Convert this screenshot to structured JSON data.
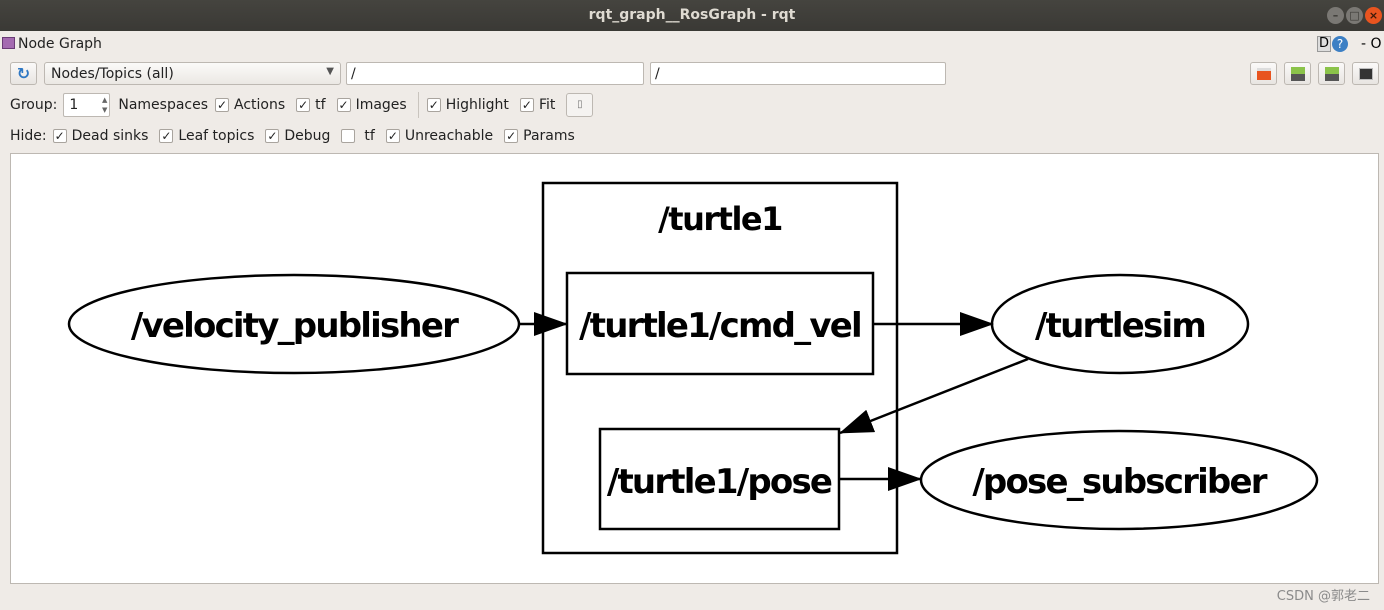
{
  "window": {
    "title": "rqt_graph__RosGraph - rqt"
  },
  "plugin": {
    "title": "Node Graph",
    "d_label": "D",
    "extra": "- O"
  },
  "toolbar": {
    "view_mode": "Nodes/Topics (all)",
    "node_filter": "/",
    "topic_filter": "/"
  },
  "options": {
    "group_label": "Group:",
    "group_value": "1",
    "items": [
      {
        "label": "Namespaces",
        "checked": null
      },
      {
        "label": "Actions",
        "checked": true
      },
      {
        "label": "tf",
        "checked": true
      },
      {
        "label": "Images",
        "checked": true
      },
      {
        "label": "Highlight",
        "checked": true
      },
      {
        "label": "Fit",
        "checked": true
      }
    ]
  },
  "hide": {
    "label": "Hide:",
    "items": [
      {
        "label": "Dead sinks",
        "checked": true
      },
      {
        "label": "Leaf topics",
        "checked": true
      },
      {
        "label": "Debug",
        "checked": true
      },
      {
        "label": "tf",
        "checked": false
      },
      {
        "label": "Unreachable",
        "checked": true
      },
      {
        "label": "Params",
        "checked": true
      }
    ]
  },
  "graph": {
    "cluster": "/turtle1",
    "nodes": {
      "velocity_publisher": "/velocity_publisher",
      "turtlesim": "/turtlesim",
      "pose_subscriber": "/pose_subscriber"
    },
    "topics": {
      "cmd_vel": "/turtle1/cmd_vel",
      "pose": "/turtle1/pose"
    },
    "edges": [
      [
        "/velocity_publisher",
        "/turtle1/cmd_vel"
      ],
      [
        "/turtle1/cmd_vel",
        "/turtlesim"
      ],
      [
        "/turtlesim",
        "/turtle1/pose"
      ],
      [
        "/turtle1/pose",
        "/pose_subscriber"
      ]
    ]
  },
  "watermark": "CSDN @郭老二"
}
